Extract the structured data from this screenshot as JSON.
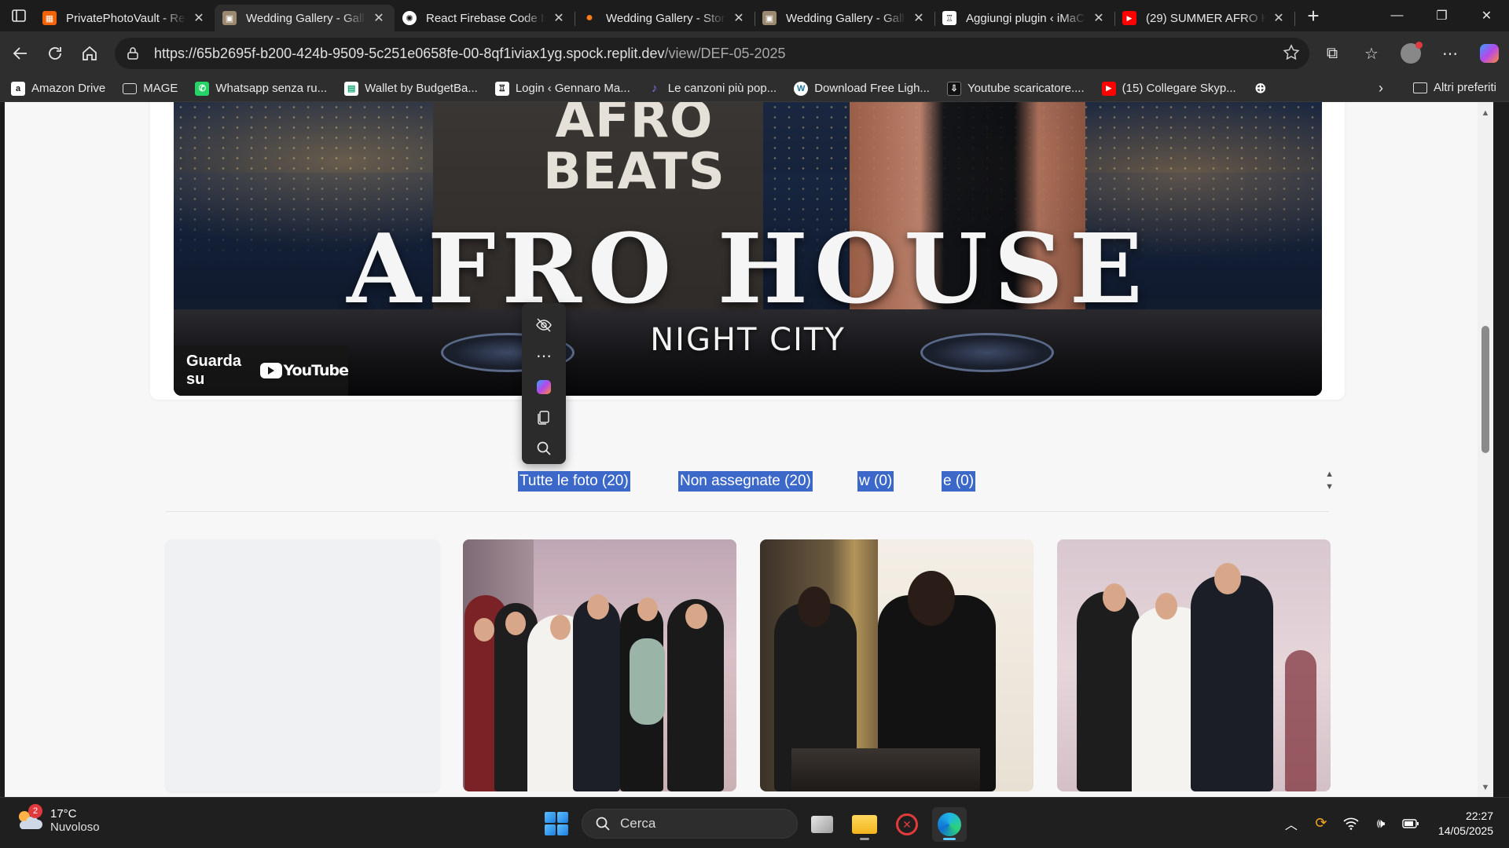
{
  "browser": {
    "tabs": [
      {
        "title": "PrivatePhotoVault - Re",
        "favicon": "replit",
        "active": false
      },
      {
        "title": "Wedding Gallery - Gall",
        "favicon": "photo",
        "active": true
      },
      {
        "title": "React Firebase Code Is",
        "favicon": "chatgpt",
        "active": false
      },
      {
        "title": "Wedding Gallery - Stor",
        "favicon": "firebase",
        "active": false
      },
      {
        "title": "Wedding Gallery - Gall",
        "favicon": "photo",
        "active": false
      },
      {
        "title": "Aggiungi plugin ‹ iMaC",
        "favicon": "wordpress",
        "active": false
      },
      {
        "title": "(29) SUMMER AFRO H",
        "favicon": "youtube",
        "active": false
      }
    ],
    "address": {
      "url_main": "https://65b2695f-b200-424b-9509-5c251e0658fe-00-8qf1iviax1yg.spock.replit.dev",
      "url_path": "/view/DEF-05-2025"
    },
    "bookmarks": [
      {
        "label": "Amazon Drive",
        "icon": "amazon-icon"
      },
      {
        "label": "MAGE",
        "icon": "folder-icon"
      },
      {
        "label": "Whatsapp senza ru...",
        "icon": "whatsapp-icon"
      },
      {
        "label": "Wallet by BudgetBa...",
        "icon": "wallet-icon"
      },
      {
        "label": "Login ‹ Gennaro Ma...",
        "icon": "login-icon"
      },
      {
        "label": "Le canzoni più pop...",
        "icon": "music-icon"
      },
      {
        "label": "Download Free Ligh...",
        "icon": "wordpress-icon"
      },
      {
        "label": "Youtube scaricatore....",
        "icon": "download-icon"
      },
      {
        "label": "(15) Collegare Skyp...",
        "icon": "youtube-icon"
      }
    ],
    "other_favorites": "Altri preferiti"
  },
  "video": {
    "shirt_line1": "AFRO",
    "shirt_line2": "BEATS",
    "title": "AFRO HOUSE",
    "subtitle": "NIGHT CITY",
    "watch_on": "Guarda su",
    "youtube_word": "YouTube"
  },
  "filters": {
    "all": "Tutte le foto (20)",
    "unassigned": "Non assegnate (20)",
    "third": "w (0)",
    "fourth": "e (0)"
  },
  "taskbar": {
    "weather_temp": "17°C",
    "weather_desc": "Nuvoloso",
    "weather_badge": "2",
    "search_placeholder": "Cerca",
    "time": "22:27",
    "date": "14/05/2025"
  }
}
